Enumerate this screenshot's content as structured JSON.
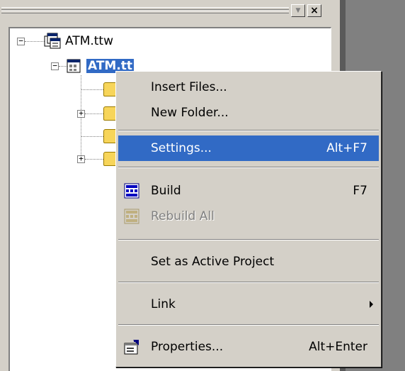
{
  "tree": {
    "workspace_label": "ATM.ttw",
    "project_label": "ATM.tt"
  },
  "menu": {
    "insert_files": "Insert Files...",
    "new_folder": "New Folder...",
    "settings": "Settings...",
    "settings_shortcut": "Alt+F7",
    "build": "Build",
    "build_shortcut": "F7",
    "rebuild_all": "Rebuild All",
    "set_active": "Set as Active Project",
    "link": "Link",
    "properties": "Properties...",
    "properties_shortcut": "Alt+Enter"
  },
  "colors": {
    "highlight": "#316ac5",
    "face": "#d4d0c8"
  }
}
